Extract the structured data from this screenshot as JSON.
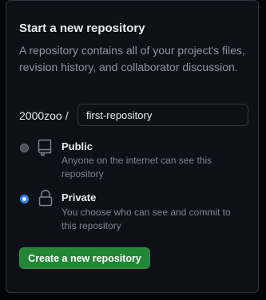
{
  "panel": {
    "title": "Start a new repository",
    "description": "A repository contains all of your project's files, revision history, and collaborator discussion."
  },
  "owner": {
    "name": "2000zoo",
    "separator": "/"
  },
  "repository_name_input": {
    "value": "first-repository"
  },
  "visibility_options": [
    {
      "label": "Public",
      "description": "Anyone on the internet can see this repository",
      "icon": "repo-icon",
      "selected": false
    },
    {
      "label": "Private",
      "description": "You choose who can see and commit to this repository",
      "icon": "lock-icon",
      "selected": true
    }
  ],
  "create_button": {
    "label": "Create a new repository"
  },
  "colors": {
    "background": "#0d1117",
    "border": "#30363d",
    "accent_blue": "#2f81f7",
    "button_green": "#238636",
    "text_primary": "#e6edf3",
    "text_muted": "#8d96a0"
  }
}
